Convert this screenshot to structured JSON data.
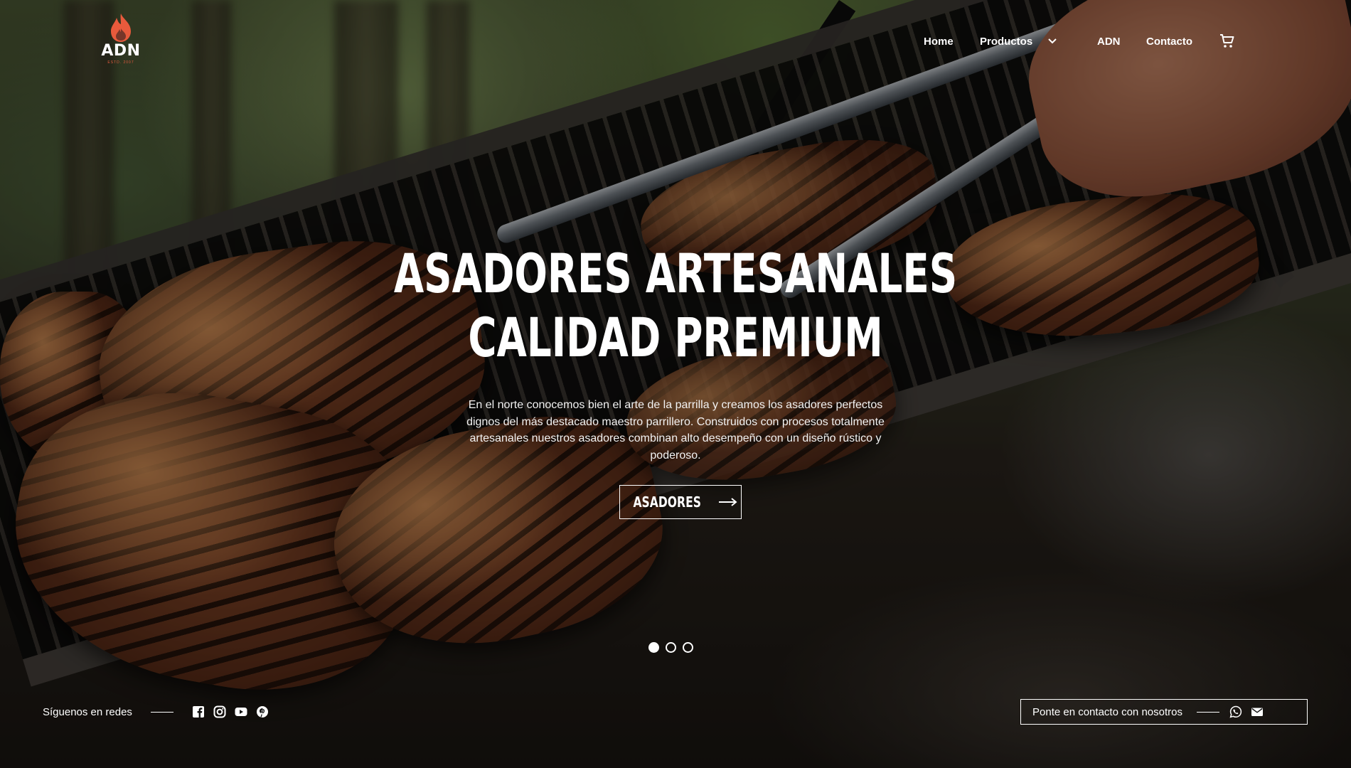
{
  "header": {
    "logo": {
      "brand": "ADN",
      "established": "ESTD. 2007"
    },
    "nav": [
      {
        "label": "Home"
      },
      {
        "label": "Productos",
        "has_dropdown": true
      },
      {
        "label": "ADN"
      },
      {
        "label": "Contacto"
      }
    ],
    "cart_icon": "shopping-cart-icon"
  },
  "hero": {
    "headline_line1": "ASADORES ARTESANALES",
    "headline_line2": "CALIDAD PREMIUM",
    "description_lines": [
      "En el norte conocemos bien el arte de la parrilla y creamos los asadores perfectos",
      "dignos del más destacado maestro parrillero. Construidos con procesos totalmente",
      "artesanales nuestros asadores combinan alto desempeño con un diseño rústico y",
      "poderoso."
    ],
    "cta_label": "ASADORES",
    "slides": {
      "count": 3,
      "active": 1
    }
  },
  "footer": {
    "social_label": "Síguenos en redes",
    "social_icons": [
      "facebook-icon",
      "instagram-icon",
      "youtube-icon",
      "pinterest-icon"
    ],
    "contact_label": "Ponte en contacto con nosotros",
    "contact_icons": [
      "whatsapp-icon",
      "email-icon"
    ]
  },
  "colors": {
    "accent": "#e85a3c",
    "text": "#ffffff"
  }
}
